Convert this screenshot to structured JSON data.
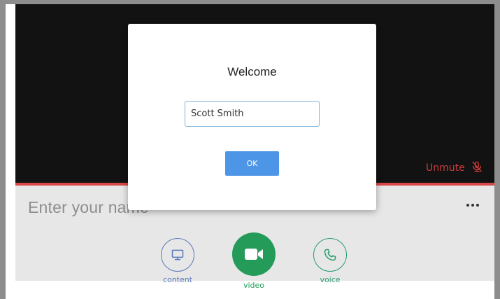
{
  "dialog": {
    "title": "Welcome",
    "name_value": "Scott Smith",
    "ok_label": "OK"
  },
  "video": {
    "unmute_label": "Unmute",
    "unmute_icon": "mic-off-icon"
  },
  "panel": {
    "name_placeholder": "Enter your name",
    "more_icon": "more-horizontal-icon"
  },
  "controls": [
    {
      "label": "content",
      "icon": "monitor-icon"
    },
    {
      "label": "video",
      "icon": "video-camera-icon"
    },
    {
      "label": "voice",
      "icon": "phone-icon"
    }
  ],
  "colors": {
    "accent_blue": "#4c95e7",
    "video_green": "#259b5a",
    "alert_red": "#d94848"
  }
}
